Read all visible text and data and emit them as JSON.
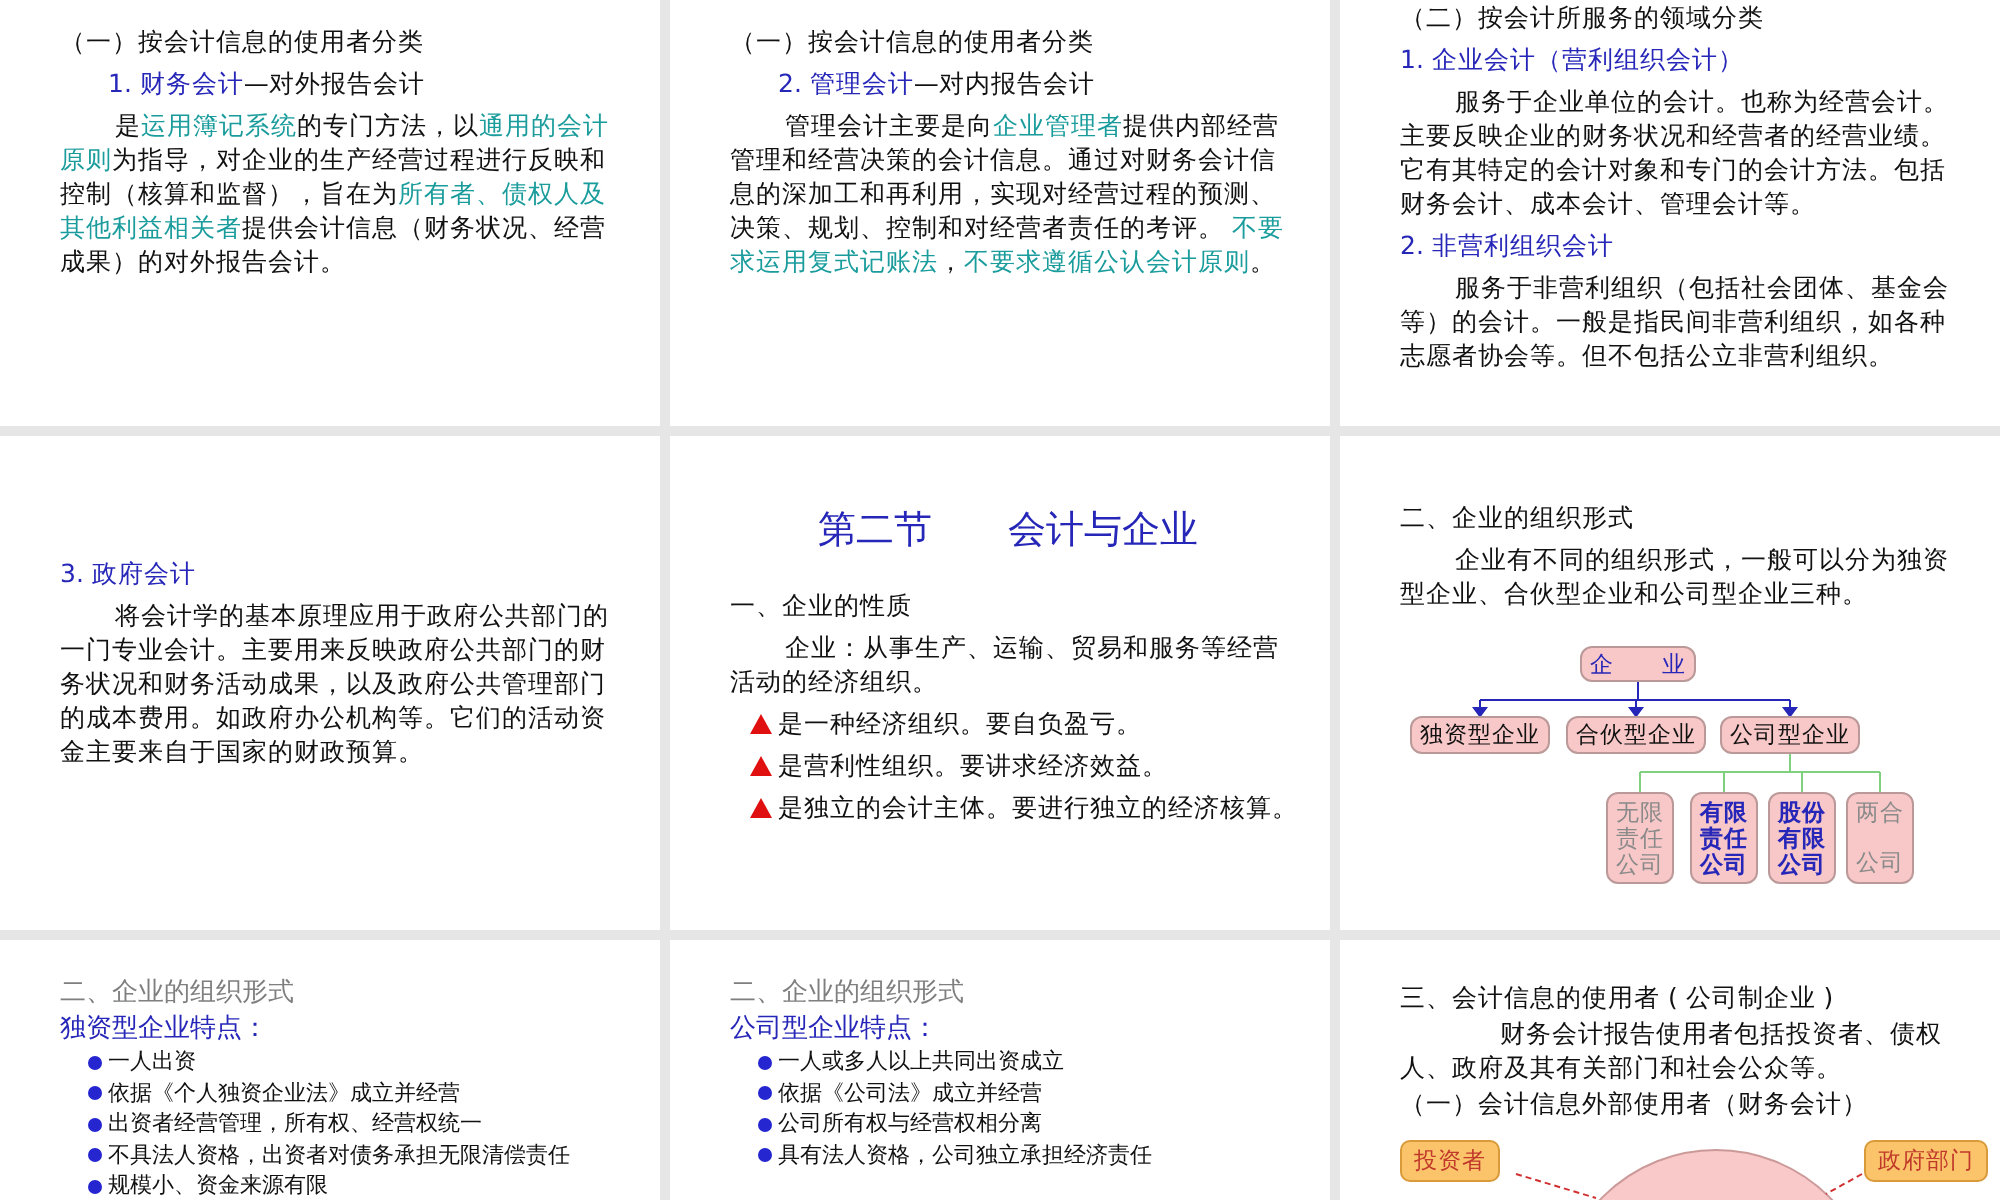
{
  "slides": [
    {
      "blocks": [
        {
          "kind": "heading",
          "runs": [
            {
              "text": "（一）按会计信息的使用者分类",
              "kind": "plain"
            }
          ]
        },
        {
          "kind": "subheading",
          "runs": [
            {
              "text": "1. 财务会计",
              "kind": "label"
            },
            {
              "text": "—对外报告会计",
              "kind": "plain"
            }
          ]
        },
        {
          "kind": "paragraph",
          "runs": [
            {
              "text": "是",
              "kind": "plain"
            },
            {
              "text": "运用簿记系统",
              "kind": "term"
            },
            {
              "text": "的专门方法，以",
              "kind": "plain"
            },
            {
              "text": "通用的会计原则",
              "kind": "term"
            },
            {
              "text": "为指导，对企业的生产经营过程进行反映和控制（核算和监督），旨在为",
              "kind": "plain"
            },
            {
              "text": "所有者、债权人及其他利益相关者",
              "kind": "term"
            },
            {
              "text": "提供会计信息（财务状况、经营成果）的对外报告会计。",
              "kind": "plain"
            }
          ]
        }
      ]
    },
    {
      "blocks": [
        {
          "kind": "heading",
          "runs": [
            {
              "text": "（一）按会计信息的使用者分类",
              "kind": "plain"
            }
          ]
        },
        {
          "kind": "subheading",
          "runs": [
            {
              "text": "2. 管理会计",
              "kind": "label"
            },
            {
              "text": "—对内报告会计",
              "kind": "plain"
            }
          ]
        },
        {
          "kind": "paragraph",
          "runs": [
            {
              "text": "管理会计主要是向",
              "kind": "plain"
            },
            {
              "text": "企业管理者",
              "kind": "term"
            },
            {
              "text": "提供内部经营管理和经营决策的会计信息。通过对财务会计信息的深加工和再利用，实现对经营过程的预测、决策、规划、控制和对经营者责任的考评。 ",
              "kind": "plain"
            },
            {
              "text": "不要求运用复式记账法",
              "kind": "term"
            },
            {
              "text": "，",
              "kind": "plain"
            },
            {
              "text": "不要求遵循公认会计原则",
              "kind": "term"
            },
            {
              "text": "。",
              "kind": "plain"
            }
          ]
        }
      ]
    },
    {
      "blocks": [
        {
          "kind": "heading",
          "runs": [
            {
              "text": "（二）按会计所服务的领域分类",
              "kind": "plain"
            }
          ]
        },
        {
          "kind": "heading",
          "runs": [
            {
              "text": "1. 企业会计（营利组织会计）",
              "kind": "label"
            }
          ]
        },
        {
          "kind": "paragraph",
          "runs": [
            {
              "text": "服务于企业单位的会计。也称为经营会计。主要反映企业的财务状况和经营者的经营业绩。它有其特定的会计对象和专门的会计方法。包括财务会计、成本会计、管理会计等。",
              "kind": "plain"
            }
          ]
        },
        {
          "kind": "heading",
          "runs": [
            {
              "text": "2. 非营利组织会计",
              "kind": "label"
            }
          ]
        },
        {
          "kind": "paragraph",
          "runs": [
            {
              "text": "服务于非营利组织（包括社会团体、基金会等）的会计。一般是指民间非营利组织，如各种志愿者协会等。但不包括公立非营利组织。",
              "kind": "plain"
            }
          ]
        }
      ]
    },
    {
      "blocks": [
        {
          "kind": "heading",
          "runs": [
            {
              "text": "3. 政府会计",
              "kind": "label"
            }
          ]
        },
        {
          "kind": "paragraph",
          "runs": [
            {
              "text": "将会计学的基本原理应用于政府公共部门的一门专业会计。主要用来反映政府公共部门的财务状况和财务活动成果，以及政府公共管理部门的成本费用。如政府办公机构等。它们的活动资金主要来自于国家的财政预算。",
              "kind": "plain"
            }
          ]
        }
      ]
    },
    {
      "blocks": [
        {
          "kind": "title",
          "runs": [
            {
              "text": "第二节　　会计与企业",
              "kind": "label"
            }
          ]
        },
        {
          "kind": "heading",
          "runs": [
            {
              "text": "一、企业的性质",
              "kind": "plain"
            }
          ]
        },
        {
          "kind": "paragraph",
          "runs": [
            {
              "text": "企业：从事生产、运输、贸易和服务等经营活动的经济组织。",
              "kind": "plain"
            }
          ]
        },
        {
          "kind": "triangle-bullet",
          "runs": [
            {
              "text": "是一种经济组织。要自负盈亏。",
              "kind": "plain"
            }
          ]
        },
        {
          "kind": "triangle-bullet",
          "runs": [
            {
              "text": "是营利性组织。要讲求经济效益。",
              "kind": "plain"
            }
          ]
        },
        {
          "kind": "triangle-bullet",
          "runs": [
            {
              "text": "是独立的会计主体。要进行独立的经济核算。",
              "kind": "plain"
            }
          ]
        }
      ]
    },
    {
      "blocks": [
        {
          "kind": "heading",
          "runs": [
            {
              "text": "二、企业的组织形式",
              "kind": "plain"
            }
          ]
        },
        {
          "kind": "paragraph",
          "runs": [
            {
              "text": "企业有不同的组织形式，一般可以分为独资型企业、合伙型企业和公司型企业三种。",
              "kind": "plain"
            }
          ]
        },
        {
          "kind": "orgchart",
          "root": "企　　业",
          "branches": [
            "独资型企业",
            "合伙型企业",
            "公司型企业"
          ],
          "children": [
            {
              "lines": [
                "无限",
                "责任",
                "公司"
              ],
              "emphasis": false
            },
            {
              "lines": [
                "有限",
                "责任",
                "公司"
              ],
              "emphasis": true
            },
            {
              "lines": [
                "股份",
                "有限",
                "公司"
              ],
              "emphasis": true
            },
            {
              "lines": [
                "两合",
                "公司"
              ],
              "emphasis": false
            }
          ]
        }
      ]
    },
    {
      "blocks": [
        {
          "kind": "heading",
          "runs": [
            {
              "text": "二、企业的组织形式",
              "kind": "muted"
            }
          ]
        },
        {
          "kind": "heading",
          "runs": [
            {
              "text": "独资型企业特点：",
              "kind": "label"
            }
          ]
        },
        {
          "kind": "dot-bullet",
          "runs": [
            {
              "text": "一人出资",
              "kind": "plain"
            }
          ]
        },
        {
          "kind": "dot-bullet",
          "runs": [
            {
              "text": "依据《个人独资企业法》成立并经营",
              "kind": "plain"
            }
          ]
        },
        {
          "kind": "dot-bullet",
          "runs": [
            {
              "text": "出资者经营管理，所有权、经营权统一",
              "kind": "plain"
            }
          ]
        },
        {
          "kind": "dot-bullet",
          "runs": [
            {
              "text": "不具法人资格，出资者对债务承担无限清偿责任",
              "kind": "plain"
            }
          ]
        },
        {
          "kind": "dot-bullet",
          "runs": [
            {
              "text": "规模小、资金来源有限",
              "kind": "plain"
            }
          ]
        }
      ]
    },
    {
      "blocks": [
        {
          "kind": "heading",
          "runs": [
            {
              "text": "二、企业的组织形式",
              "kind": "muted"
            }
          ]
        },
        {
          "kind": "heading",
          "runs": [
            {
              "text": "公司型企业特点：",
              "kind": "label"
            }
          ]
        },
        {
          "kind": "dot-bullet",
          "runs": [
            {
              "text": "一人或多人以上共同出资成立",
              "kind": "plain"
            }
          ]
        },
        {
          "kind": "dot-bullet",
          "runs": [
            {
              "text": "依据《公司法》成立并经营",
              "kind": "plain"
            }
          ]
        },
        {
          "kind": "dot-bullet",
          "runs": [
            {
              "text": "公司所有权与经营权相分离",
              "kind": "plain"
            }
          ]
        },
        {
          "kind": "dot-bullet",
          "runs": [
            {
              "text": "具有法人资格，公司独立承担经济责任",
              "kind": "plain"
            }
          ]
        }
      ]
    },
    {
      "blocks": [
        {
          "kind": "heading",
          "runs": [
            {
              "text": "三、会计信息的使用者 ( 公司制企业 )",
              "kind": "plain"
            }
          ]
        },
        {
          "kind": "paragraph",
          "runs": [
            {
              "text": "财务会计报告使用者包括投资者、债权人、政府及其有关部门和社会公众等。",
              "kind": "plain"
            }
          ]
        },
        {
          "kind": "heading",
          "runs": [
            {
              "text": "（一）会计信息外部使用者（财务会计）",
              "kind": "plain"
            }
          ]
        },
        {
          "kind": "users",
          "left": "投资者",
          "right": "政府部门"
        }
      ]
    }
  ]
}
